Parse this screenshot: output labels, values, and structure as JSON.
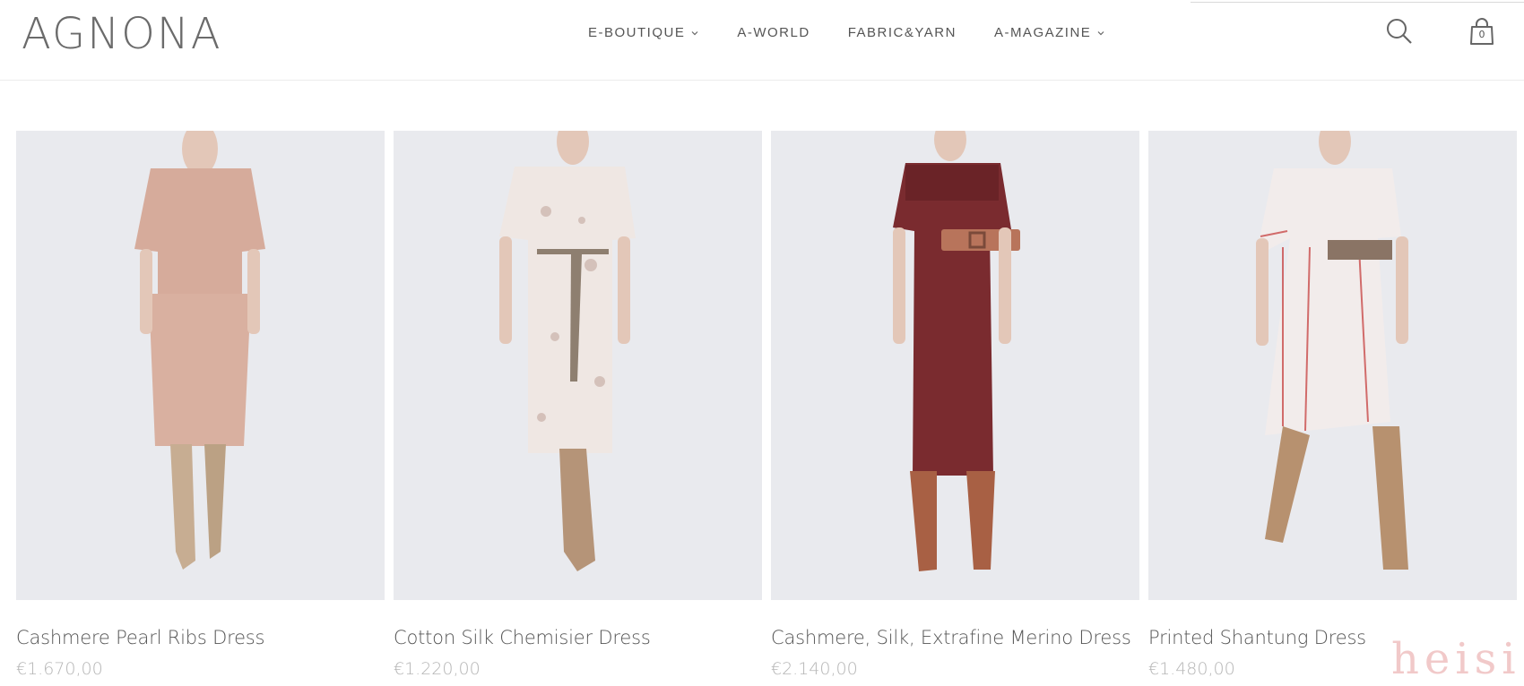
{
  "brand": {
    "logo": "AGNONA"
  },
  "nav": {
    "items": [
      {
        "label": "E-BOUTIQUE",
        "has_dropdown": true
      },
      {
        "label": "A-WORLD",
        "has_dropdown": false
      },
      {
        "label": "FABRIC&YARN",
        "has_dropdown": false
      },
      {
        "label": "A-MAGAZINE",
        "has_dropdown": true
      }
    ]
  },
  "header_icons": {
    "search": "search-icon",
    "bag": "shopping-bag-icon",
    "bag_count": "0"
  },
  "products": [
    {
      "name": "Cashmere Pearl Ribs Dress",
      "price": "€1.670,00",
      "color": "#d9ad9e",
      "boots": "#c7ad92"
    },
    {
      "name": "Cotton Silk Chemisier Dress",
      "price": "€1.220,00",
      "color": "#efe7e3",
      "boots": "#b59478"
    },
    {
      "name": "Cashmere, Silk, Extrafine Merino Dress",
      "price": "€2.140,00",
      "color": "#7a2b2f",
      "boots": "#a86044"
    },
    {
      "name": "Printed Shantung Dress",
      "price": "€1.480,00",
      "color": "#f2eceb",
      "boots": "#b7916f"
    }
  ],
  "watermark": "heisi",
  "colors": {
    "background": "#ffffff",
    "text": "#555555",
    "price": "#b6b6b6",
    "photo_bg": "#e9eaee"
  }
}
